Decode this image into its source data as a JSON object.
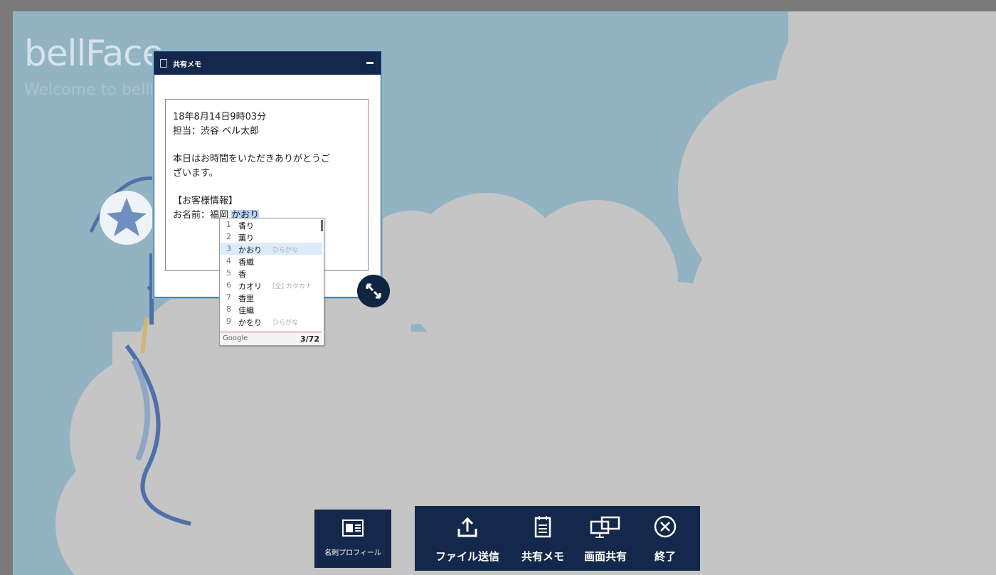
{
  "app": {
    "brand": "bellFace",
    "tagline": "Welcome to bellFace"
  },
  "memo_window": {
    "title": "共有メモ",
    "lines": [
      "18年8月14日9時03分",
      "担当：渋谷 ベル太郎",
      "",
      "本日はお時間をいただきありがとうご",
      "ざいます。",
      "",
      "【お客様情報】",
      "お名前：福岡 "
    ],
    "composing_text": "かおり"
  },
  "ime": {
    "candidates": [
      {
        "num": "1",
        "word": "香り",
        "hint": ""
      },
      {
        "num": "2",
        "word": "薫り",
        "hint": ""
      },
      {
        "num": "3",
        "word": "かおり",
        "hint": "ひらがな"
      },
      {
        "num": "4",
        "word": "香織",
        "hint": ""
      },
      {
        "num": "5",
        "word": "香",
        "hint": ""
      },
      {
        "num": "6",
        "word": "カオリ",
        "hint": "[全] カタカナ"
      },
      {
        "num": "7",
        "word": "香里",
        "hint": ""
      },
      {
        "num": "8",
        "word": "佳織",
        "hint": ""
      },
      {
        "num": "9",
        "word": "かをり",
        "hint": "ひらがな"
      }
    ],
    "selected_index": 3,
    "source": "Google",
    "page": "3/72"
  },
  "toolbar": {
    "profile_label": "名刺プロフィール",
    "items": [
      {
        "label": "ファイル送信",
        "icon": "upload-icon"
      },
      {
        "label": "共有メモ",
        "icon": "notepad-icon"
      },
      {
        "label": "画面共有",
        "icon": "screen-share-icon"
      },
      {
        "label": "終了",
        "icon": "close-circle-icon"
      }
    ]
  },
  "colors": {
    "sky": "#92b3c2",
    "cloud": "#c5c5c5",
    "navy": "#13284a",
    "highlight": "#b8d3ff"
  }
}
